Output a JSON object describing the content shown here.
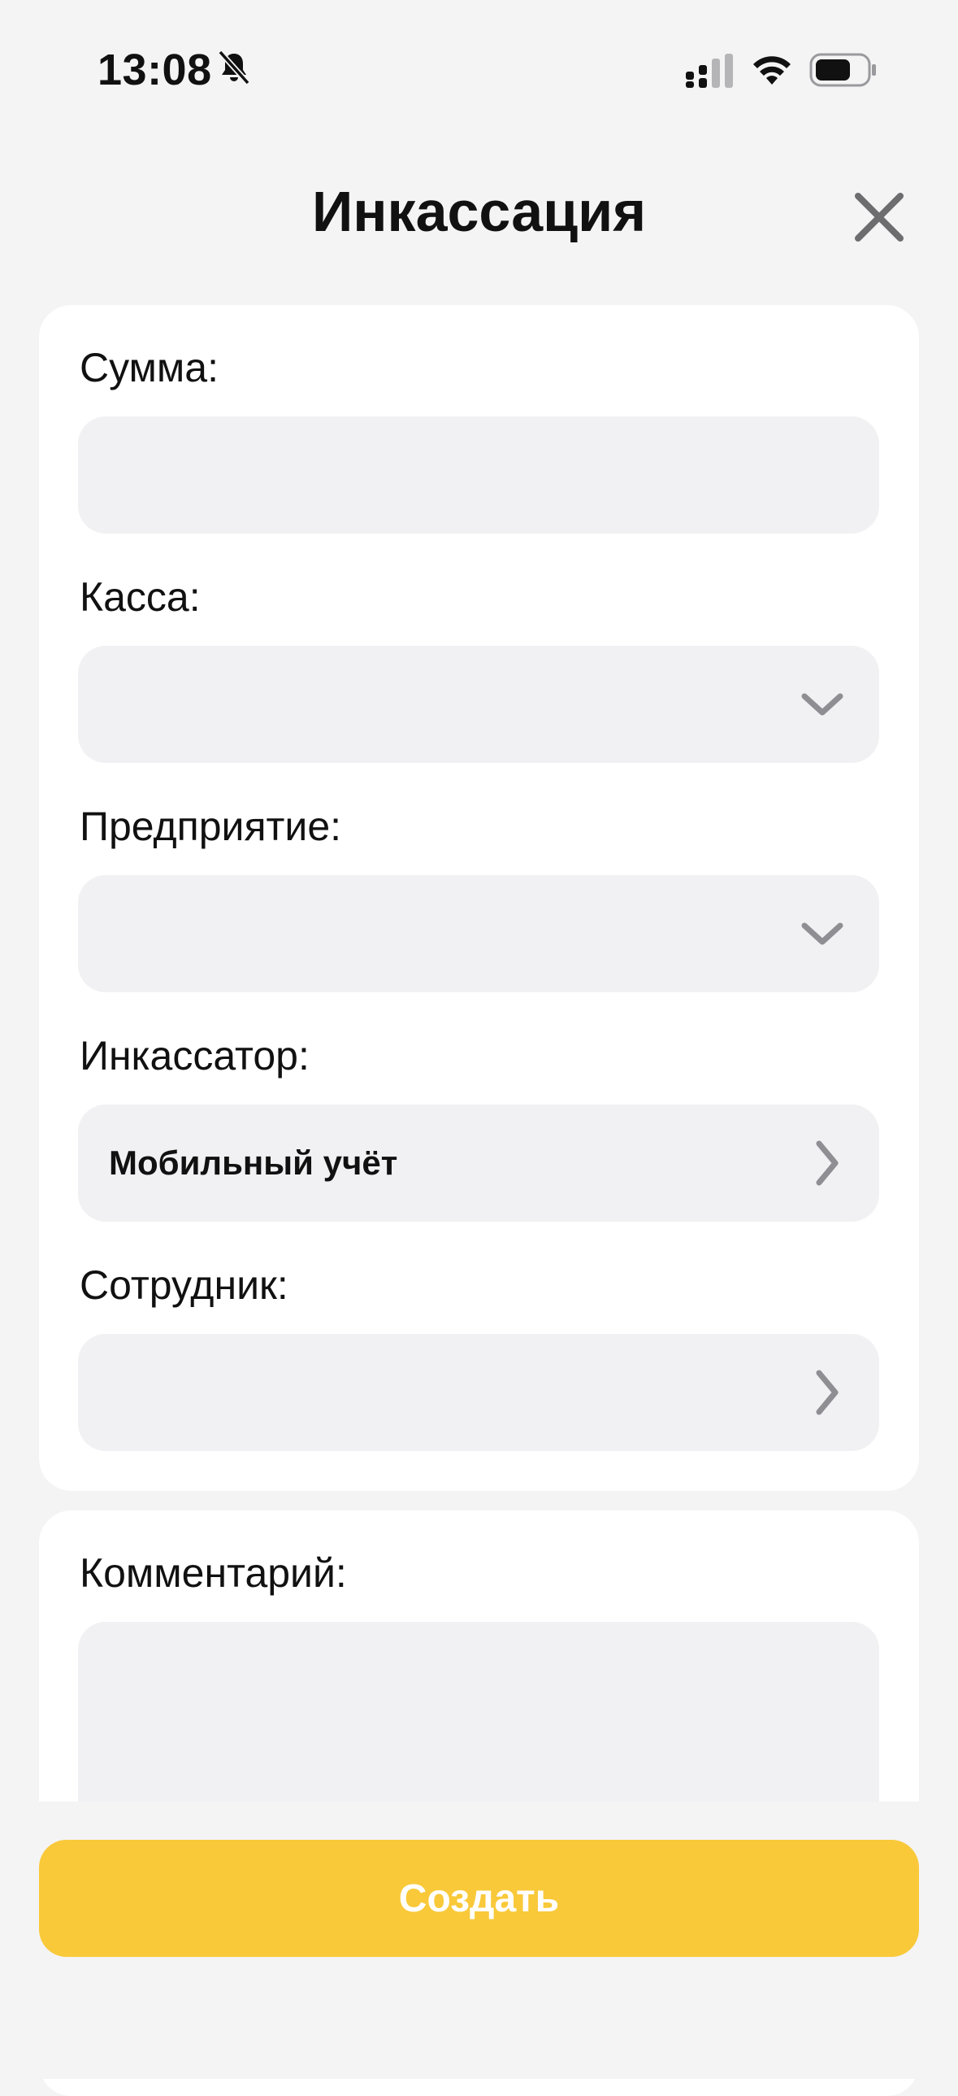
{
  "status_bar": {
    "time": "13:08",
    "icons": [
      "bell-slash-icon",
      "cellular-signal-icon",
      "wifi-icon",
      "battery-icon"
    ]
  },
  "header": {
    "title": "Инкассация",
    "close_icon": "close-icon"
  },
  "form": {
    "amount": {
      "label": "Сумма:",
      "value": ""
    },
    "cashbox": {
      "label": "Касса:",
      "value": "",
      "icon": "chevron-down-icon"
    },
    "enterprise": {
      "label": "Предприятие:",
      "value": "",
      "icon": "chevron-down-icon"
    },
    "collector": {
      "label": "Инкассатор:",
      "value": "Мобильный учёт",
      "icon": "chevron-right-icon"
    },
    "employee": {
      "label": "Сотрудник:",
      "value": "",
      "icon": "chevron-right-icon"
    },
    "comment": {
      "label": "Комментарий:",
      "value": ""
    }
  },
  "actions": {
    "create_label": "Создать"
  },
  "colors": {
    "background": "#f4f4f5",
    "card": "#ffffff",
    "field": "#f1f1f3",
    "accent": "#f9c93a",
    "icon_gray": "#8e8e93"
  }
}
